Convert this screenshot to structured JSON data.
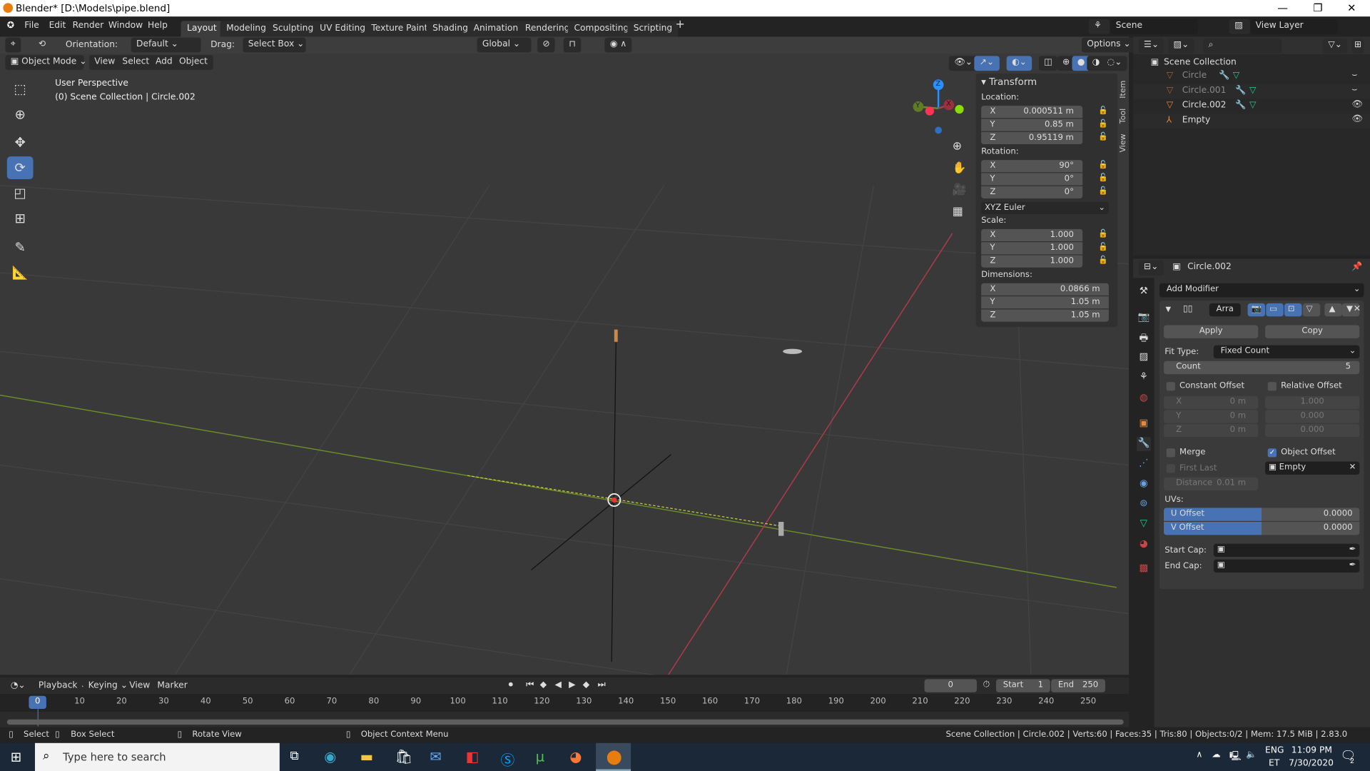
{
  "window": {
    "title": "Blender* [D:\\Models\\pipe.blend]",
    "controls": [
      "—",
      "❐",
      "✕"
    ]
  },
  "menus": [
    "File",
    "Edit",
    "Render",
    "Window",
    "Help"
  ],
  "workspaces": [
    "Layout",
    "Modeling",
    "Sculpting",
    "UV Editing",
    "Texture Paint",
    "Shading",
    "Animation",
    "Rendering",
    "Compositing",
    "Scripting"
  ],
  "active_workspace": "Layout",
  "scene": {
    "name": "Scene",
    "view_layer": "View Layer"
  },
  "tool_header": {
    "orientation_label": "Orientation:",
    "orientation": "Default",
    "drag_label": "Drag:",
    "drag": "Select Box",
    "transform_orientation": "Global",
    "options": "Options"
  },
  "view_header": {
    "mode": "Object Mode",
    "menus": [
      "View",
      "Select",
      "Add",
      "Object"
    ]
  },
  "viewport": {
    "perspective": "User Perspective",
    "collection_info": "(0) Scene Collection | Circle.002",
    "axes": [
      "X",
      "Y",
      "Z"
    ]
  },
  "n_panel": {
    "title": "Transform",
    "tabs": [
      "Item",
      "Tool",
      "View"
    ],
    "location_label": "Location:",
    "location": [
      {
        "k": "X",
        "v": "0.000511 m"
      },
      {
        "k": "Y",
        "v": "0.85 m"
      },
      {
        "k": "Z",
        "v": "0.95119 m"
      }
    ],
    "rotation_label": "Rotation:",
    "rotation": [
      {
        "k": "X",
        "v": "90°"
      },
      {
        "k": "Y",
        "v": "0°"
      },
      {
        "k": "Z",
        "v": "0°"
      }
    ],
    "rotation_mode": "XYZ Euler",
    "scale_label": "Scale:",
    "scale": [
      {
        "k": "X",
        "v": "1.000"
      },
      {
        "k": "Y",
        "v": "1.000"
      },
      {
        "k": "Z",
        "v": "1.000"
      }
    ],
    "dimensions_label": "Dimensions:",
    "dimensions": [
      {
        "k": "X",
        "v": "0.0866 m"
      },
      {
        "k": "Y",
        "v": "1.05 m"
      },
      {
        "k": "Z",
        "v": "1.05 m"
      }
    ]
  },
  "outliner": {
    "root": "Scene Collection",
    "items": [
      {
        "name": "Circle",
        "visible": false
      },
      {
        "name": "Circle.001",
        "visible": false
      },
      {
        "name": "Circle.002",
        "visible": true,
        "active": true
      },
      {
        "name": "Empty",
        "visible": true
      }
    ]
  },
  "properties": {
    "object": "Circle.002",
    "add_modifier": "Add Modifier",
    "modifier_name": "Arra",
    "apply": "Apply",
    "copy": "Copy",
    "fit_type_label": "Fit Type:",
    "fit_type": "Fixed Count",
    "count_label": "Count",
    "count": "5",
    "constant_offset": {
      "label": "Constant Offset",
      "checked": false,
      "values": [
        {
          "k": "X",
          "v": "0 m"
        },
        {
          "k": "Y",
          "v": "0 m"
        },
        {
          "k": "Z",
          "v": "0 m"
        }
      ]
    },
    "relative_offset": {
      "label": "Relative Offset",
      "checked": false,
      "values": [
        "1.000",
        "0.000",
        "0.000"
      ]
    },
    "merge": {
      "label": "Merge",
      "checked": false
    },
    "first_last": {
      "label": "First Last",
      "checked": false
    },
    "distance_label": "Distance",
    "distance": "0.01 m",
    "object_offset": {
      "label": "Object Offset",
      "checked": true,
      "object": "Empty"
    },
    "uvs_label": "UVs:",
    "u_offset_label": "U Offset",
    "u_offset": "0.0000",
    "v_offset_label": "V Offset",
    "v_offset": "0.0000",
    "start_cap_label": "Start Cap:",
    "end_cap_label": "End Cap:"
  },
  "timeline": {
    "menus": [
      "Playback",
      "Keying",
      "View",
      "Marker"
    ],
    "current_frame": "0",
    "start_label": "Start",
    "start": "1",
    "end_label": "End",
    "end": "250",
    "ticks": [
      "0",
      "10",
      "20",
      "30",
      "40",
      "50",
      "60",
      "70",
      "80",
      "90",
      "100",
      "110",
      "120",
      "130",
      "140",
      "150",
      "160",
      "170",
      "180",
      "190",
      "200",
      "210",
      "220",
      "230",
      "240",
      "250"
    ]
  },
  "statusbar": {
    "select": "Select",
    "box_select": "Box Select",
    "rotate_view": "Rotate View",
    "context_menu": "Object Context Menu",
    "stats": "Scene Collection | Circle.002 | Verts:60 | Faces:35 | Tris:80 | Objects:0/2 | Mem: 17.5 MiB | 2.83.0"
  },
  "taskbar": {
    "search_placeholder": "Type here to search",
    "lang": "ENG",
    "lang2": "ET",
    "time": "11:09 PM",
    "date": "7/30/2020",
    "notifications": "2"
  },
  "colors": {
    "accent": "#4772b3",
    "x_axis": "#ff3352",
    "y_axis": "#8bdc00",
    "z_axis": "#2890ff",
    "object_orange": "#e8893a"
  }
}
